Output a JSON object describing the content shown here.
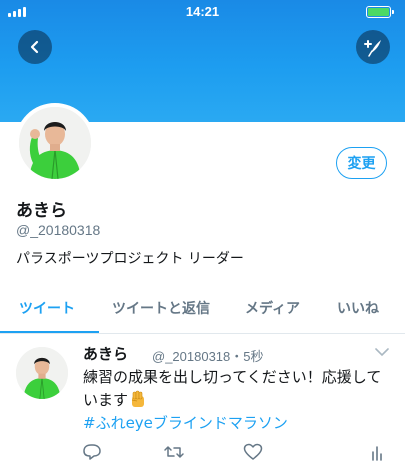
{
  "status_bar": {
    "time": "14:21",
    "battery_level": 1.0,
    "battery_color": "#4cd964"
  },
  "header": {
    "gradient_top": "#1a8ae6",
    "gradient_bottom": "#2aa9f2",
    "back_icon": "back-arrow-icon",
    "compose_icon": "compose-tweet-icon"
  },
  "profile": {
    "display_name": "あきら",
    "handle": "@_20180318",
    "bio": "パラスポーツプロジェクト リーダー",
    "edit_label": "変更"
  },
  "tabs": [
    {
      "label": "ツイート",
      "active": true
    },
    {
      "label": "ツイートと返信",
      "active": false
    },
    {
      "label": "メディア",
      "active": false
    },
    {
      "label": "いいね",
      "active": false
    }
  ],
  "tweet": {
    "name": "あきら",
    "meta": "@_20180318・5秒",
    "text": "練習の成果を出し切ってください！応援しています",
    "hashtag": "#ふれeyeブラインドマラソン",
    "emoji_icon": "raised-fist-icon"
  },
  "accent_color": "#1da1f2"
}
